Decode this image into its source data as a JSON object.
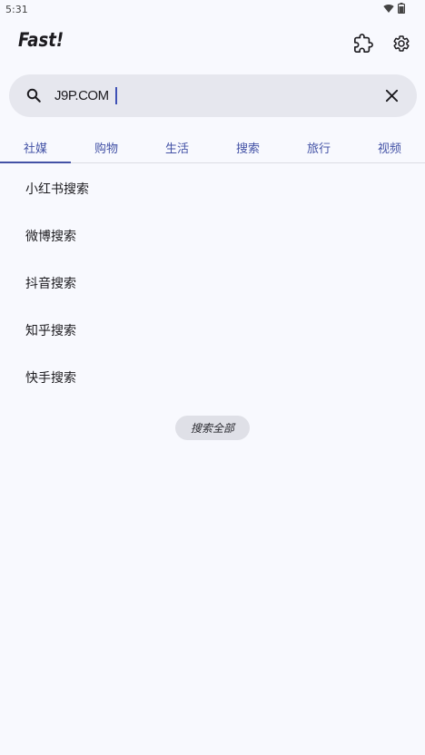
{
  "status_bar": {
    "time": "5:31"
  },
  "app_bar": {
    "title": "Fast!"
  },
  "search": {
    "query": "J9P.COM"
  },
  "tabs": [
    {
      "label": "社媒",
      "selected": true
    },
    {
      "label": "购物",
      "selected": false
    },
    {
      "label": "生活",
      "selected": false
    },
    {
      "label": "搜索",
      "selected": false
    },
    {
      "label": "旅行",
      "selected": false
    },
    {
      "label": "视频",
      "selected": false
    }
  ],
  "list": [
    {
      "label": "小红书搜索"
    },
    {
      "label": "微博搜索"
    },
    {
      "label": "抖音搜索"
    },
    {
      "label": "知乎搜索"
    },
    {
      "label": "快手搜索"
    }
  ],
  "search_all_label": "搜索全部",
  "colors": {
    "accent": "#4352a6",
    "background": "#f8f9fe",
    "search_bar": "#e6e7ee"
  }
}
